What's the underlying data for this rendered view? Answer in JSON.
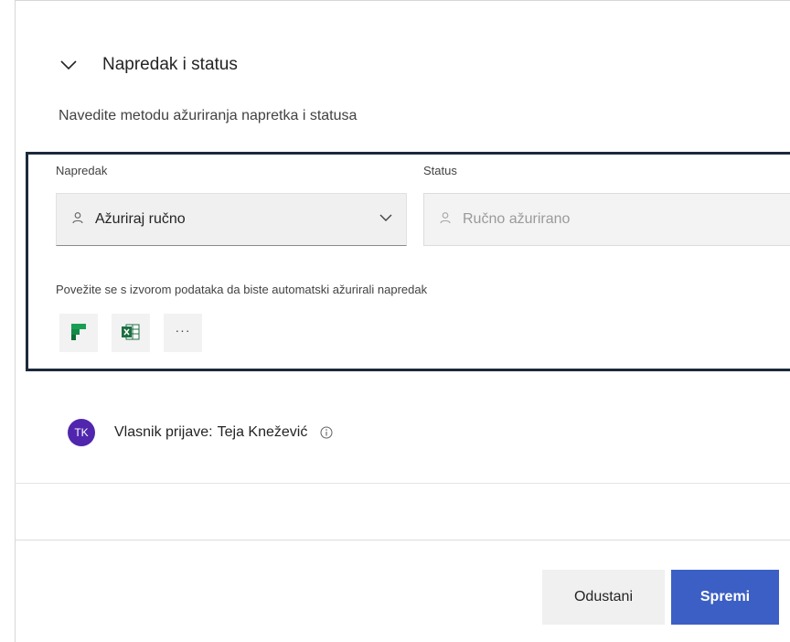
{
  "section": {
    "title": "Napredak i status",
    "description": "Navedite metodu ažuriranja napretka i statusa"
  },
  "progress": {
    "label": "Napredak",
    "selected": "Ažuriraj ručno"
  },
  "status": {
    "label": "Status",
    "placeholder": "Ručno ažurirano"
  },
  "data_source": {
    "prompt": "Povežite se s izvorom podataka da biste automatski ažurirali napredak",
    "more_label": "···"
  },
  "owner": {
    "label": "Vlasnik prijave:",
    "name": "Teja Knežević",
    "initials": "TK"
  },
  "footer": {
    "cancel_label": "Odustani",
    "save_label": "Spremi"
  },
  "colors": {
    "avatar": "#4f26ad",
    "primary": "#3b5fc4",
    "highlight_border": "#1b2a3b",
    "planner_green": "#1a9e55",
    "excel_green": "#1d6f42"
  },
  "icons": {
    "collapse": "chevron-down-icon",
    "person": "person-icon",
    "dropdown": "chevron-down-icon",
    "planner": "planner-icon",
    "excel": "excel-icon",
    "more": "more-icon",
    "info": "info-icon"
  }
}
